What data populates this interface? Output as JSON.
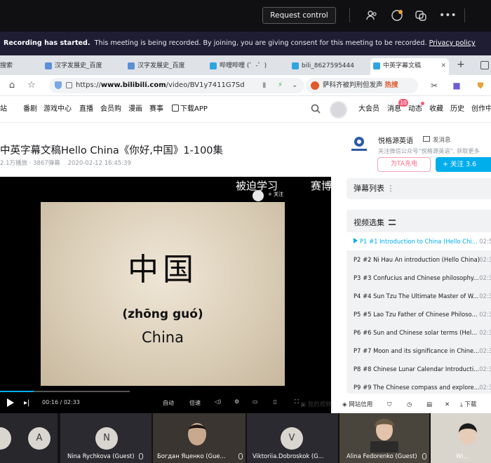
{
  "teams": {
    "request_control": "Request control",
    "recording": {
      "bold": "Recording has started.",
      "text": "This meeting is being recorded. By joining, you are giving consent for this meeting to be recorded.",
      "link": "Privacy policy"
    },
    "participants": [
      {
        "initial": "",
        "name": ""
      },
      {
        "initial": "A",
        "name": ""
      },
      {
        "initial": "N",
        "name": "Nina Rychkova (Guest)"
      },
      {
        "initial": "",
        "name": "Богдан Яценко (Gue..."
      },
      {
        "initial": "V",
        "name": "Viktoriia.Dobroskok (G..."
      },
      {
        "initial": "",
        "name": "Alina Fedorenko (Guest)"
      },
      {
        "initial": "",
        "name": "Wi..."
      }
    ]
  },
  "browser": {
    "tabs": [
      {
        "label": "搜索"
      },
      {
        "label": "汉字发展史_百度"
      },
      {
        "label": "汉字发展史_百度"
      },
      {
        "label": "哔哩哔哩 (゜-゜)"
      },
      {
        "label": "bili_8627595444"
      },
      {
        "label": "中英字幕文稿"
      }
    ],
    "url_prefix": "https://",
    "url_domain": "www.bilibili.com",
    "url_path": "/video/BV1y7411G7Sd",
    "search_text": "萨科齐被判刑但发声",
    "search_hot": "热搜"
  },
  "bilibili": {
    "nav_left": [
      "站",
      "番剧",
      "游戏中心",
      "直播",
      "会员购",
      "漫画",
      "赛事"
    ],
    "download_app": "下载APP",
    "nav_right": [
      "大会员",
      "消息",
      "动态",
      "收藏",
      "历史",
      "创作中"
    ],
    "msg_badge": "10",
    "video_title": "中英字幕文稿Hello China《你好,中国》1-100集",
    "meta": {
      "plays": "2.1万播放",
      "danmaku": "3867弹幕",
      "date": "2020-02-12 16:45:39"
    },
    "uploader": {
      "name": "悦格源英语",
      "message": "发消息",
      "desc": "关注微信公众号“悦格源英语”, 获取更多",
      "charge": "为TA充电",
      "follow": "+  关注 3.6"
    },
    "player": {
      "overlay_left": "被迫学习",
      "overlay_right": "赛博",
      "overlay_follow": "+ 关注",
      "character": "中国",
      "pinyin": "(zhōng guó)",
      "english": "China",
      "time": "00:16 / 02:33",
      "ctrl_a": "自动",
      "ctrl_b": "倍速",
      "progress": 0.26
    },
    "danmaku_list": "弹幕列表",
    "playlist_title": "视频选集",
    "playlist": [
      {
        "p": "P1",
        "title": "#1 Introduction to China (Hello Chi...",
        "time": "02:5"
      },
      {
        "p": "P2",
        "title": "#2 Ni Hau An introduction (Hello China)",
        "time": "02:3"
      },
      {
        "p": "P3",
        "title": "#3 Confucius and Chinese philosophy...",
        "time": "02:3"
      },
      {
        "p": "P4",
        "title": "#4 Sun Tzu The Ultimate Master of W...",
        "time": "02:3"
      },
      {
        "p": "P5",
        "title": "#5 Lao Tzu Father of Chinese Philoso...",
        "time": "02:3"
      },
      {
        "p": "P6",
        "title": "#6 Sun and Chinese solar terms (Hel...",
        "time": "02:3"
      },
      {
        "p": "P7",
        "title": "#7 Moon and its significance in Chine...",
        "time": "02:3"
      },
      {
        "p": "P8",
        "title": "#8 Chinese Lunar Calendar Introducti...",
        "time": "02:3"
      },
      {
        "p": "P9",
        "title": "#9 The Chinese compass and explore...",
        "time": "02:3"
      }
    ],
    "bottom": {
      "my_video": "我的视频",
      "network": "网站信用",
      "download": "下载"
    }
  },
  "colors": {
    "bilibili_blue": "#00aeec",
    "bilibili_pink": "#f85a7a",
    "teams_banner": "#1e1d33"
  }
}
